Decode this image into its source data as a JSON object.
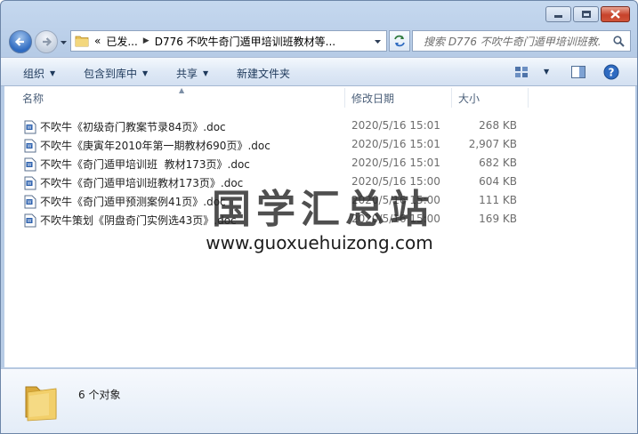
{
  "window": {
    "address": {
      "prefix": "«",
      "crumbs": [
        "已发...",
        "D776 不吹牛奇门遁甲培训班教材等..."
      ]
    },
    "search_placeholder": "搜索 D776 不吹牛奇门遁甲培训班教..."
  },
  "toolbar": {
    "organize": "组织",
    "include_in_library": "包含到库中",
    "share": "共享",
    "new_folder": "新建文件夹"
  },
  "columns": {
    "name": "名称",
    "date_modified": "修改日期",
    "size": "大小"
  },
  "files": [
    {
      "name": "不吹牛《初级奇门教案节录84页》.doc",
      "date": "2020/5/16 15:01",
      "size": "268 KB"
    },
    {
      "name": "不吹牛《庚寅年2010年第一期教材690页》.doc",
      "date": "2020/5/16 15:01",
      "size": "2,907 KB"
    },
    {
      "name": "不吹牛《奇门遁甲培训班  教材173页》.doc",
      "date": "2020/5/16 15:01",
      "size": "682 KB"
    },
    {
      "name": "不吹牛《奇门遁甲培训班教材173页》.doc",
      "date": "2020/5/16 15:00",
      "size": "604 KB"
    },
    {
      "name": "不吹牛《奇门遁甲预测案例41页》.doc",
      "date": "2020/5/16 15:00",
      "size": "111 KB"
    },
    {
      "name": "不吹牛策划《阴盘奇门实例选43页》.doc",
      "date": "2020/5/16 15:00",
      "size": "169 KB"
    }
  ],
  "watermark": {
    "text": "国学汇总站",
    "url": "www.guoxuehuizong.com"
  },
  "status": {
    "item_count": "6 个对象"
  },
  "colors": {
    "accent": "#2f6bc1",
    "close_button": "#c7422a",
    "toolbar_text": "#1e395b"
  }
}
